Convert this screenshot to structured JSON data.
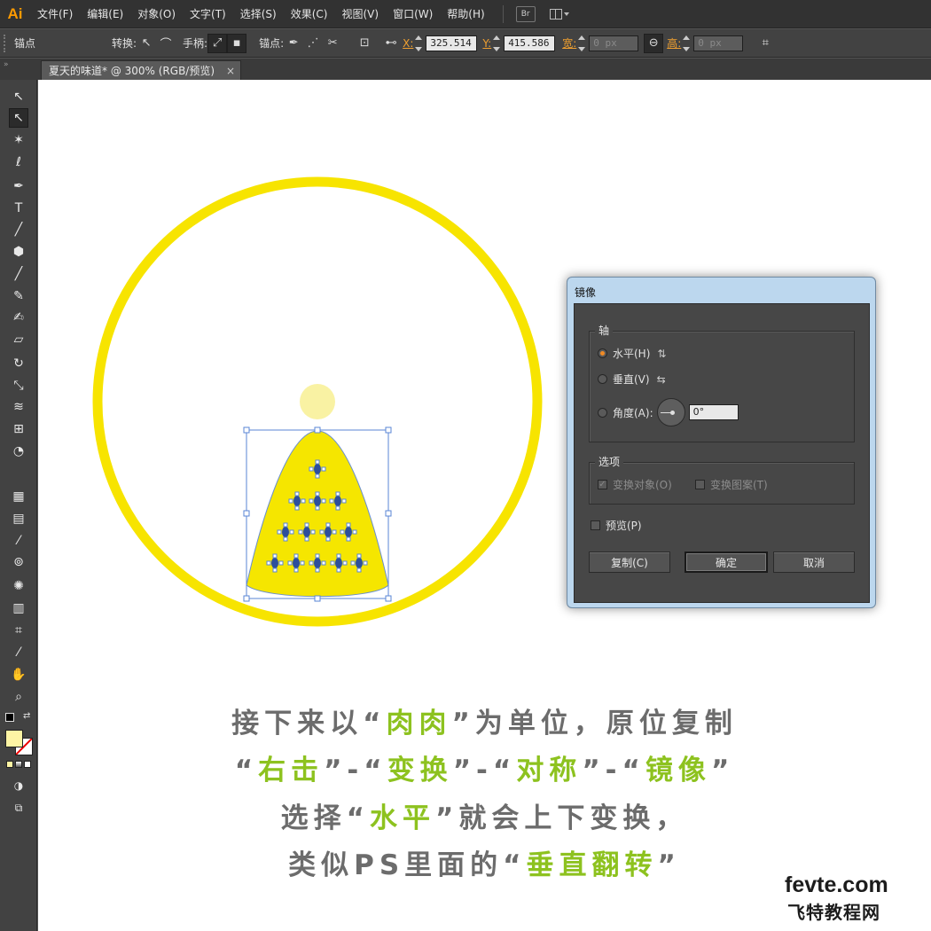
{
  "app": {
    "logo": "Ai"
  },
  "menu": [
    "文件(F)",
    "编辑(E)",
    "对象(O)",
    "文字(T)",
    "选择(S)",
    "效果(C)",
    "视图(V)",
    "窗口(W)",
    "帮助(H)"
  ],
  "menu_extra": {
    "bridge": "Br"
  },
  "controlbar": {
    "mode_label": "锚点",
    "convert_label": "转换:",
    "handles_label": "手柄:",
    "anchors_label": "锚点:",
    "x_label": "X:",
    "x_value": "325.514",
    "y_label": "Y:",
    "y_value": "415.586",
    "w_label": "宽:",
    "w_value": "0 px",
    "h_label": "高:",
    "h_value": "0 px"
  },
  "document_tab": {
    "title": "夏天的味道* @ 300% (RGB/预览)",
    "close": "×"
  },
  "tools": [
    "selection-tool-icon",
    "direct-selection-tool-icon",
    "magic-wand-icon",
    "lasso-icon",
    "pen-icon",
    "type-icon",
    "line-icon",
    "shape-icon",
    "paintbrush-icon",
    "pencil-icon",
    "blob-brush-icon",
    "eraser-icon",
    "rotate-icon",
    "scale-icon",
    "width-icon",
    "free-transform-icon",
    "shape-builder-icon",
    "perspective-grid-icon",
    "gradient-icon",
    "eyedropper-icon",
    "blend-icon",
    "symbol-sprayer-icon",
    "graph-icon",
    "artboard-icon",
    "slice-icon",
    "hand-icon",
    "zoom-icon"
  ],
  "swatches": {
    "fill": "#fdf4a4",
    "stroke": "none"
  },
  "artwork": {
    "ring_color": "#f7e400",
    "dot_color": "#f9f2a3",
    "cone_color": "#f5e600"
  },
  "dialog": {
    "title": "镜像",
    "axis_group": "轴",
    "horizontal": "水平(H)",
    "vertical": "垂直(V)",
    "angle": "角度(A):",
    "angle_value": "0°",
    "options_group": "选项",
    "transform_objects": "变换对象(O)",
    "transform_patterns": "变换图案(T)",
    "preview": "预览(P)",
    "copy_button": "复制(C)",
    "ok_button": "确定",
    "cancel_button": "取消"
  },
  "caption": {
    "line1": {
      "a": "接下来以“",
      "b": "肉肉",
      "c": "”为单位，原位复制"
    },
    "line2": {
      "q1": "“",
      "b1": "右击",
      "s1": "”-“",
      "b2": "变换",
      "s2": "”-“",
      "b3": "对称",
      "s3": "”-“",
      "b4": "镜像",
      "q2": "”"
    },
    "line3": {
      "a": "选择“",
      "b": "水平",
      "c": "”就会上下变换，"
    },
    "line4": {
      "a": "类似PS里面的“",
      "b": "垂直翻转",
      "c": "”"
    }
  },
  "watermark": {
    "domain": "fevte.com",
    "site": "飞特教程网"
  }
}
